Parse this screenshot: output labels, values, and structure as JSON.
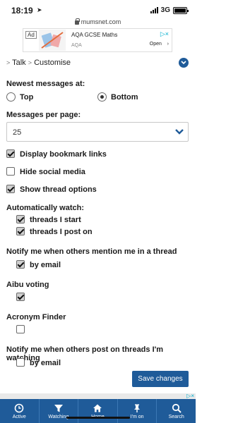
{
  "status_bar": {
    "time": "18:19",
    "network": "3G"
  },
  "url_bar": {
    "url": "mumsnet.com"
  },
  "ad": {
    "badge": "Ad",
    "title": "AQA GCSE Maths",
    "subtitle": "AQA",
    "cta": "Open",
    "cta_arrow": "›",
    "choices_icon": "▷×"
  },
  "breadcrumb": {
    "sep1": ">",
    "item1": "Talk",
    "sep2": ">",
    "item2": "Customise"
  },
  "newest_messages": {
    "label": "Newest messages at:",
    "options": [
      {
        "label": "Top",
        "selected": false
      },
      {
        "label": "Bottom",
        "selected": true
      }
    ]
  },
  "messages_per_page": {
    "label": "Messages per page:",
    "value": "25"
  },
  "checkboxes": {
    "display_bookmark_links": {
      "label": "Display bookmark links",
      "checked": true
    },
    "hide_social_media": {
      "label": "Hide social media",
      "checked": false
    },
    "show_thread_options": {
      "label": "Show thread options",
      "checked": true
    }
  },
  "automatically_watch": {
    "label": "Automatically watch:",
    "threads_i_start": {
      "label": "threads I start",
      "checked": true
    },
    "threads_i_post_on": {
      "label": "threads I post on",
      "checked": true
    }
  },
  "notify_mention": {
    "label": "Notify me when others mention me in a thread",
    "by_email": {
      "label": "by email",
      "checked": true
    }
  },
  "aibu_voting": {
    "label": "Aibu voting",
    "checked": true
  },
  "acronym_finder": {
    "label": "Acronym Finder",
    "checked": false
  },
  "notify_watching": {
    "label": "Notify me when others post on threads I'm watching",
    "by_email": {
      "label": "by email",
      "checked": false
    }
  },
  "save_button": {
    "label": "Save changes"
  },
  "bottom_nav": {
    "items": [
      {
        "label": "Active",
        "icon": "clock-icon"
      },
      {
        "label": "Watching",
        "icon": "filter-icon"
      },
      {
        "label": "Home",
        "icon": "home-icon"
      },
      {
        "label": "I'm on",
        "icon": "pin-icon"
      },
      {
        "label": "Search",
        "icon": "search-icon"
      }
    ]
  },
  "colors": {
    "brand_blue": "#1f5b99",
    "text": "#1a1a1a"
  }
}
